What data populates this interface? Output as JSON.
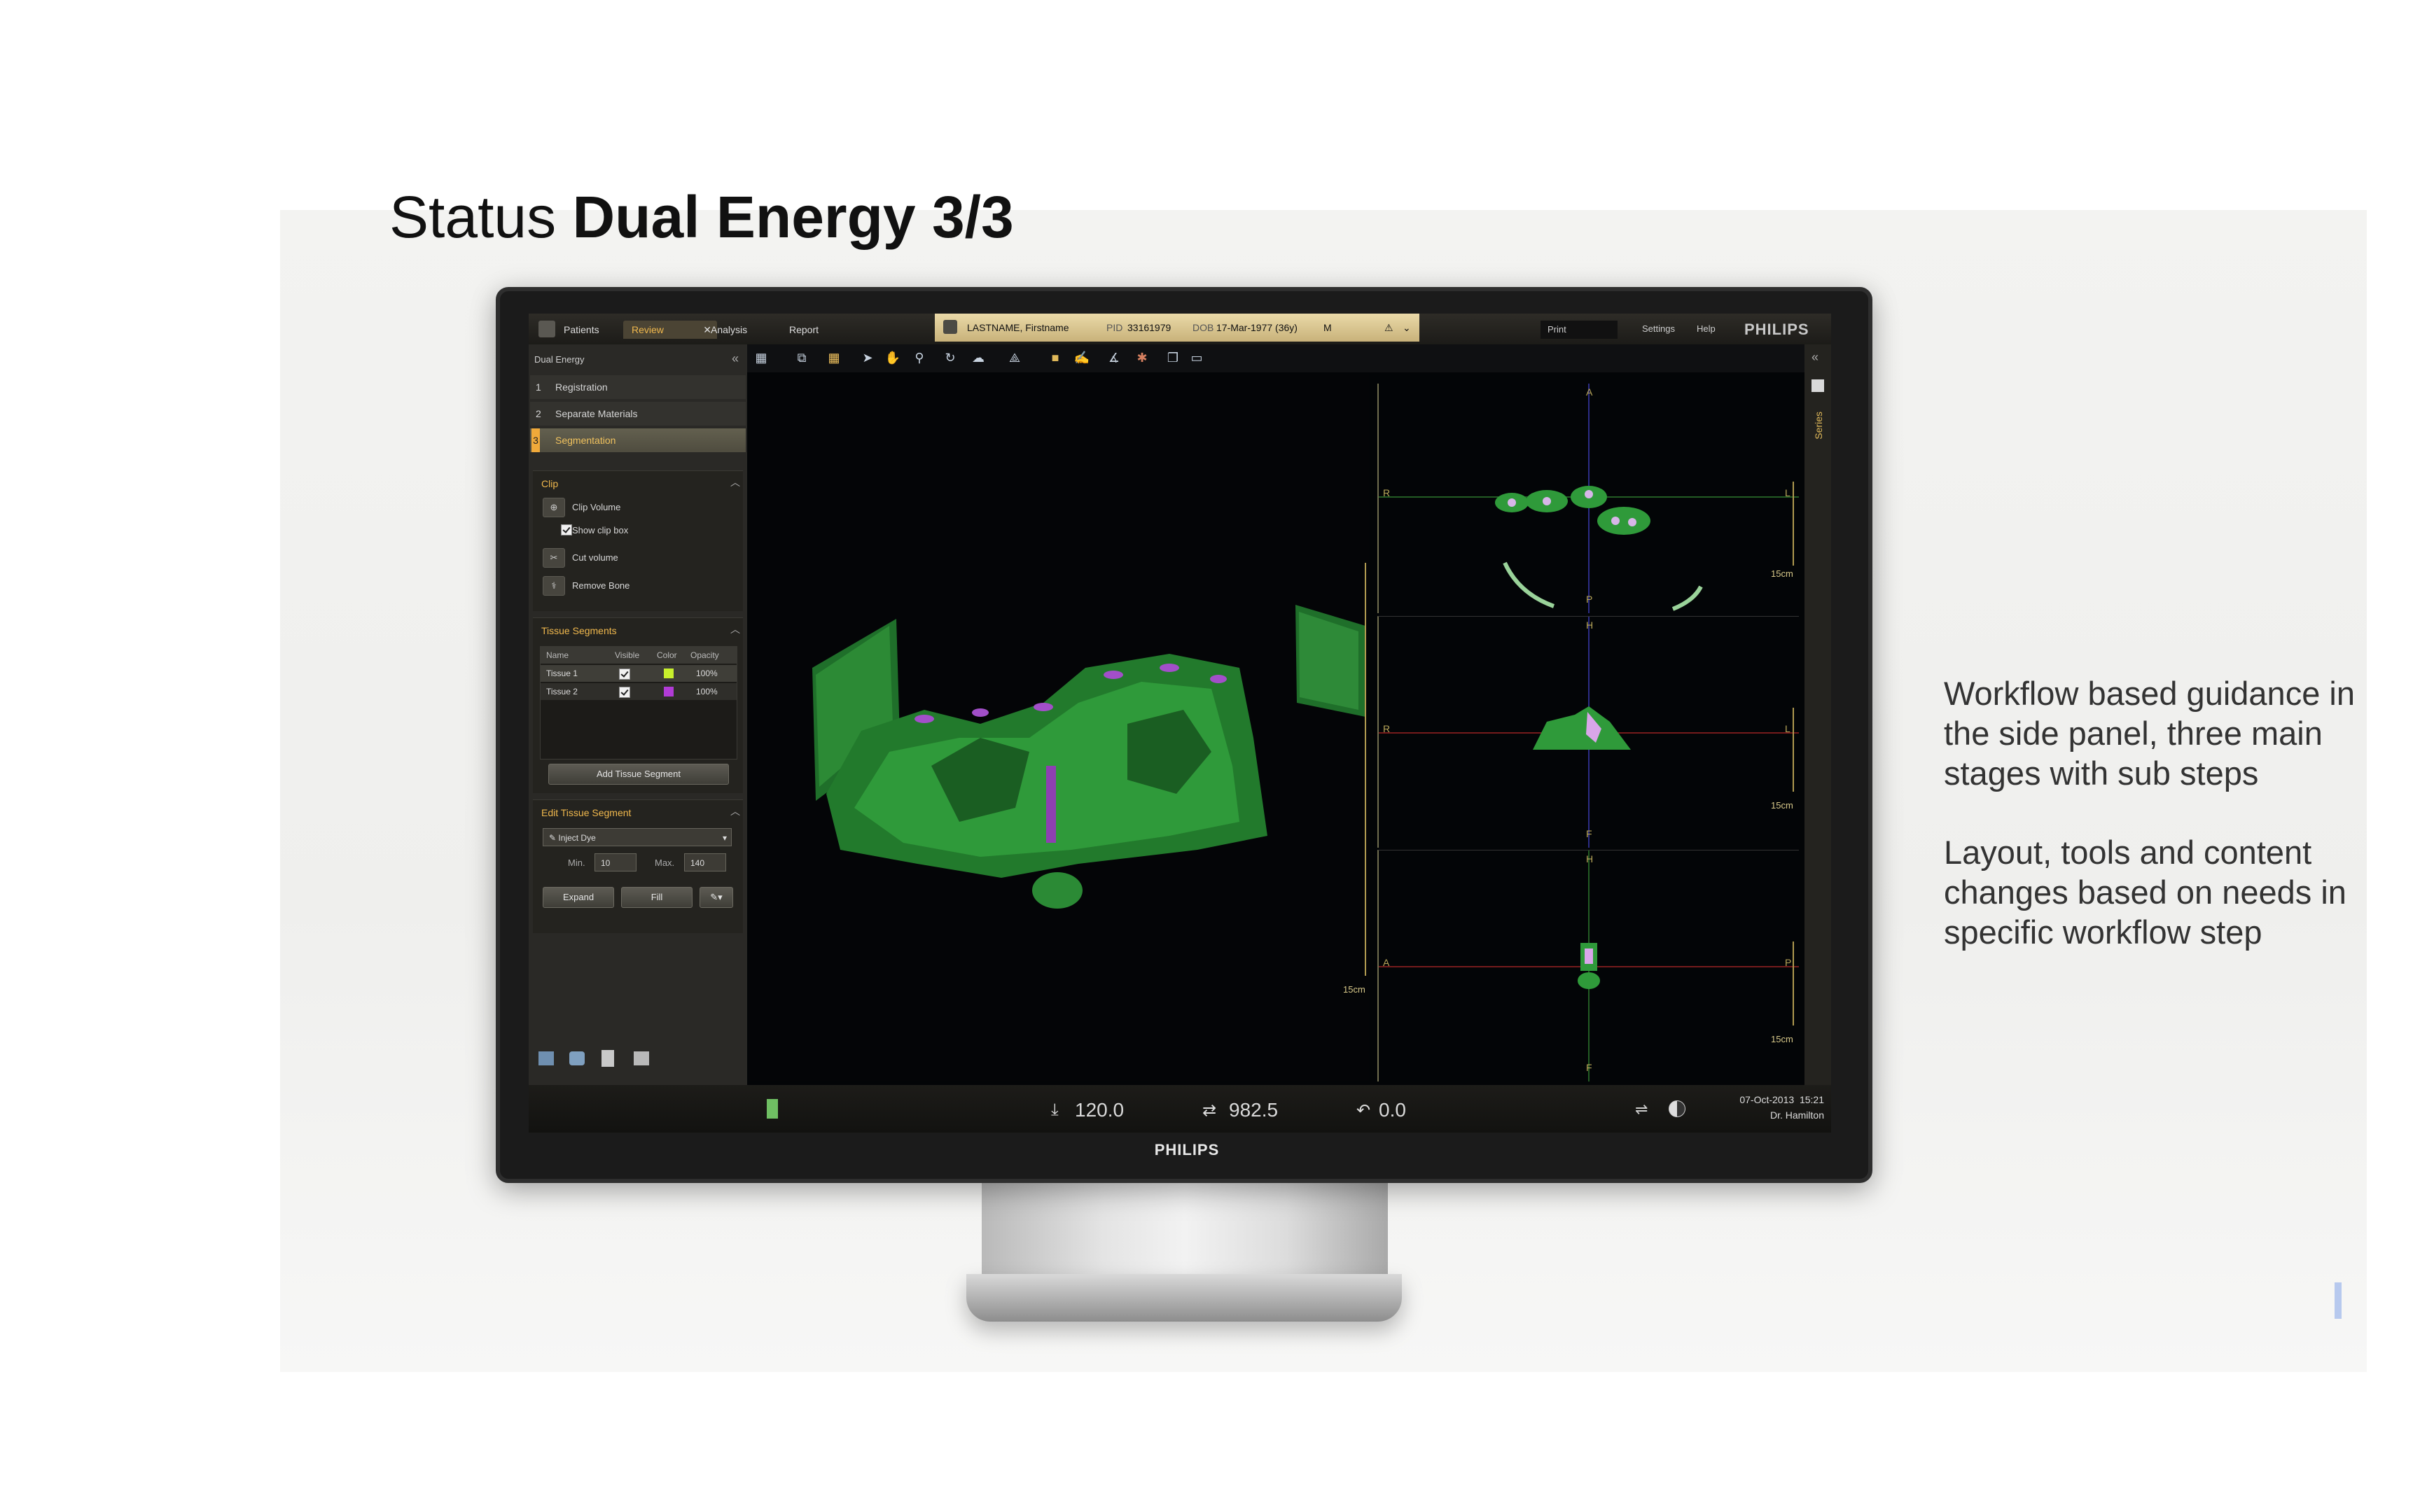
{
  "slide": {
    "title_prefix": "Status",
    "title_bold": "Dual Energy 3/3",
    "notes": [
      "Workflow based guidance in the side panel, three main stages with sub steps",
      "Layout, tools and content changes based on needs in specific workflow step"
    ]
  },
  "monitor": {
    "bezel_brand": "PHILIPS"
  },
  "app": {
    "tabs": {
      "patients": "Patients",
      "review": "Review",
      "review_close": "✕",
      "analysis": "Analysis",
      "report": "Report"
    },
    "patient": {
      "name": "LASTNAME, Firstname",
      "pid_label": "PID",
      "pid": "33161979",
      "dob_label": "DOB",
      "dob": "17-Mar-1977 (36y)",
      "sex": "M",
      "warning": "⚠",
      "expand": "⌄"
    },
    "top_right": {
      "print": "Print",
      "settings": "Settings",
      "help": "Help",
      "brand": "PHILIPS"
    },
    "side": {
      "title": "Dual Energy",
      "collapse": "«",
      "steps": [
        {
          "num": "1",
          "label": "Registration"
        },
        {
          "num": "2",
          "label": "Separate Materials"
        },
        {
          "num": "3",
          "label": "Segmentation"
        }
      ],
      "clip": {
        "title": "Clip",
        "clip_volume": "Clip Volume",
        "show_clip_box": "Show clip box",
        "cut_volume": "Cut volume",
        "remove_bone": "Remove Bone"
      },
      "tissue": {
        "title": "Tissue Segments",
        "headers": [
          "Name",
          "Visible",
          "Color",
          "Opacity"
        ],
        "rows": [
          {
            "name": "Tissue 1",
            "color": "#c7ef2c",
            "opacity": "100%"
          },
          {
            "name": "Tissue 2",
            "color": "#b13bd6",
            "opacity": "100%"
          }
        ],
        "add_button": "Add Tissue Segment"
      },
      "edit": {
        "title": "Edit Tissue Segment",
        "tool": "Inject Dye",
        "min_label": "Min.",
        "min_value": "10",
        "max_label": "Max.",
        "max_value": "140",
        "expand": "Expand",
        "fill": "Fill"
      }
    },
    "views": {
      "scale": "15cm",
      "axial": {
        "top": "A",
        "left": "R",
        "right": "L",
        "bottom": "P"
      },
      "coronal": {
        "top": "H",
        "left": "R",
        "right": "L",
        "bottom": "F"
      },
      "sagittal": {
        "top": "H",
        "left": "A",
        "right": "P",
        "bottom": "F"
      }
    },
    "right_rail": {
      "series": "Series",
      "collapse": "«"
    },
    "status": {
      "kv": "120.0",
      "mas": "982.5",
      "tilt": "0.0",
      "date": "07-Oct-2013",
      "time": "15:21",
      "user": "Dr. Hamilton"
    }
  },
  "colors": {
    "accent": "#f0b84d",
    "tissue_green": "#2e8a3a",
    "tissue_pink": "#b13bd6"
  }
}
